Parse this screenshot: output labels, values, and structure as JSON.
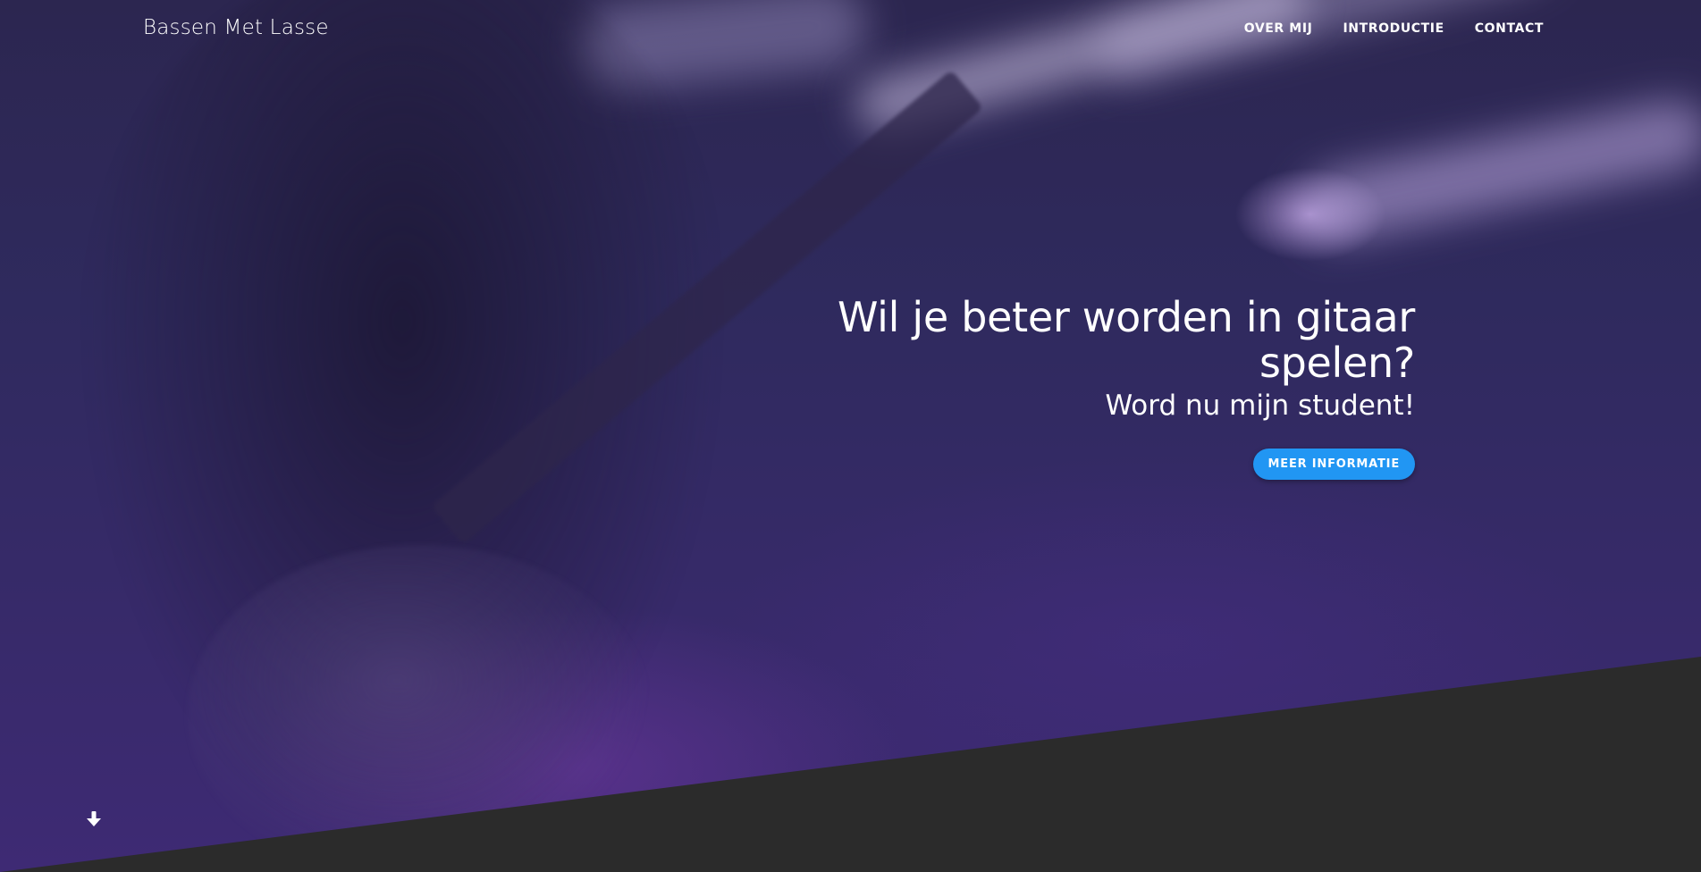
{
  "brand": {
    "title": "Bassen Met Lasse"
  },
  "nav": {
    "items": [
      {
        "label": "OVER MIJ"
      },
      {
        "label": "INTRODUCTIE"
      },
      {
        "label": "CONTACT"
      }
    ]
  },
  "hero": {
    "title": "Wil je beter worden in gitaar spelen?",
    "subtitle": "Word nu mijn student!",
    "cta_label": "MEER INFORMATIE",
    "scroll_icon": "arrow-down-icon"
  },
  "colors": {
    "accent": "#2196f3",
    "footer_band": "#2b2b2b",
    "overlay": "#2f2a5e"
  }
}
